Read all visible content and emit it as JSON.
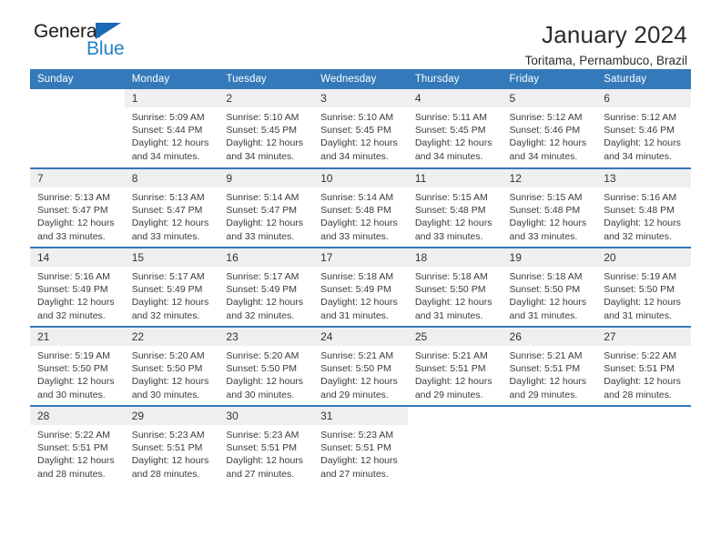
{
  "brand": {
    "name_part1": "General",
    "name_part2": "Blue",
    "triangle_icon": "triangle-icon",
    "accent_color": "#2581c4",
    "header_color": "#3479ba"
  },
  "header": {
    "title": "January 2024",
    "subtitle": "Toritama, Pernambuco, Brazil"
  },
  "weekday_headers": [
    "Sunday",
    "Monday",
    "Tuesday",
    "Wednesday",
    "Thursday",
    "Friday",
    "Saturday"
  ],
  "weeks": [
    [
      {
        "day": "",
        "sunrise": "",
        "sunset": "",
        "daylight1": "",
        "daylight2": ""
      },
      {
        "day": "1",
        "sunrise": "Sunrise: 5:09 AM",
        "sunset": "Sunset: 5:44 PM",
        "daylight1": "Daylight: 12 hours",
        "daylight2": "and 34 minutes."
      },
      {
        "day": "2",
        "sunrise": "Sunrise: 5:10 AM",
        "sunset": "Sunset: 5:45 PM",
        "daylight1": "Daylight: 12 hours",
        "daylight2": "and 34 minutes."
      },
      {
        "day": "3",
        "sunrise": "Sunrise: 5:10 AM",
        "sunset": "Sunset: 5:45 PM",
        "daylight1": "Daylight: 12 hours",
        "daylight2": "and 34 minutes."
      },
      {
        "day": "4",
        "sunrise": "Sunrise: 5:11 AM",
        "sunset": "Sunset: 5:45 PM",
        "daylight1": "Daylight: 12 hours",
        "daylight2": "and 34 minutes."
      },
      {
        "day": "5",
        "sunrise": "Sunrise: 5:12 AM",
        "sunset": "Sunset: 5:46 PM",
        "daylight1": "Daylight: 12 hours",
        "daylight2": "and 34 minutes."
      },
      {
        "day": "6",
        "sunrise": "Sunrise: 5:12 AM",
        "sunset": "Sunset: 5:46 PM",
        "daylight1": "Daylight: 12 hours",
        "daylight2": "and 34 minutes."
      }
    ],
    [
      {
        "day": "7",
        "sunrise": "Sunrise: 5:13 AM",
        "sunset": "Sunset: 5:47 PM",
        "daylight1": "Daylight: 12 hours",
        "daylight2": "and 33 minutes."
      },
      {
        "day": "8",
        "sunrise": "Sunrise: 5:13 AM",
        "sunset": "Sunset: 5:47 PM",
        "daylight1": "Daylight: 12 hours",
        "daylight2": "and 33 minutes."
      },
      {
        "day": "9",
        "sunrise": "Sunrise: 5:14 AM",
        "sunset": "Sunset: 5:47 PM",
        "daylight1": "Daylight: 12 hours",
        "daylight2": "and 33 minutes."
      },
      {
        "day": "10",
        "sunrise": "Sunrise: 5:14 AM",
        "sunset": "Sunset: 5:48 PM",
        "daylight1": "Daylight: 12 hours",
        "daylight2": "and 33 minutes."
      },
      {
        "day": "11",
        "sunrise": "Sunrise: 5:15 AM",
        "sunset": "Sunset: 5:48 PM",
        "daylight1": "Daylight: 12 hours",
        "daylight2": "and 33 minutes."
      },
      {
        "day": "12",
        "sunrise": "Sunrise: 5:15 AM",
        "sunset": "Sunset: 5:48 PM",
        "daylight1": "Daylight: 12 hours",
        "daylight2": "and 33 minutes."
      },
      {
        "day": "13",
        "sunrise": "Sunrise: 5:16 AM",
        "sunset": "Sunset: 5:48 PM",
        "daylight1": "Daylight: 12 hours",
        "daylight2": "and 32 minutes."
      }
    ],
    [
      {
        "day": "14",
        "sunrise": "Sunrise: 5:16 AM",
        "sunset": "Sunset: 5:49 PM",
        "daylight1": "Daylight: 12 hours",
        "daylight2": "and 32 minutes."
      },
      {
        "day": "15",
        "sunrise": "Sunrise: 5:17 AM",
        "sunset": "Sunset: 5:49 PM",
        "daylight1": "Daylight: 12 hours",
        "daylight2": "and 32 minutes."
      },
      {
        "day": "16",
        "sunrise": "Sunrise: 5:17 AM",
        "sunset": "Sunset: 5:49 PM",
        "daylight1": "Daylight: 12 hours",
        "daylight2": "and 32 minutes."
      },
      {
        "day": "17",
        "sunrise": "Sunrise: 5:18 AM",
        "sunset": "Sunset: 5:49 PM",
        "daylight1": "Daylight: 12 hours",
        "daylight2": "and 31 minutes."
      },
      {
        "day": "18",
        "sunrise": "Sunrise: 5:18 AM",
        "sunset": "Sunset: 5:50 PM",
        "daylight1": "Daylight: 12 hours",
        "daylight2": "and 31 minutes."
      },
      {
        "day": "19",
        "sunrise": "Sunrise: 5:18 AM",
        "sunset": "Sunset: 5:50 PM",
        "daylight1": "Daylight: 12 hours",
        "daylight2": "and 31 minutes."
      },
      {
        "day": "20",
        "sunrise": "Sunrise: 5:19 AM",
        "sunset": "Sunset: 5:50 PM",
        "daylight1": "Daylight: 12 hours",
        "daylight2": "and 31 minutes."
      }
    ],
    [
      {
        "day": "21",
        "sunrise": "Sunrise: 5:19 AM",
        "sunset": "Sunset: 5:50 PM",
        "daylight1": "Daylight: 12 hours",
        "daylight2": "and 30 minutes."
      },
      {
        "day": "22",
        "sunrise": "Sunrise: 5:20 AM",
        "sunset": "Sunset: 5:50 PM",
        "daylight1": "Daylight: 12 hours",
        "daylight2": "and 30 minutes."
      },
      {
        "day": "23",
        "sunrise": "Sunrise: 5:20 AM",
        "sunset": "Sunset: 5:50 PM",
        "daylight1": "Daylight: 12 hours",
        "daylight2": "and 30 minutes."
      },
      {
        "day": "24",
        "sunrise": "Sunrise: 5:21 AM",
        "sunset": "Sunset: 5:50 PM",
        "daylight1": "Daylight: 12 hours",
        "daylight2": "and 29 minutes."
      },
      {
        "day": "25",
        "sunrise": "Sunrise: 5:21 AM",
        "sunset": "Sunset: 5:51 PM",
        "daylight1": "Daylight: 12 hours",
        "daylight2": "and 29 minutes."
      },
      {
        "day": "26",
        "sunrise": "Sunrise: 5:21 AM",
        "sunset": "Sunset: 5:51 PM",
        "daylight1": "Daylight: 12 hours",
        "daylight2": "and 29 minutes."
      },
      {
        "day": "27",
        "sunrise": "Sunrise: 5:22 AM",
        "sunset": "Sunset: 5:51 PM",
        "daylight1": "Daylight: 12 hours",
        "daylight2": "and 28 minutes."
      }
    ],
    [
      {
        "day": "28",
        "sunrise": "Sunrise: 5:22 AM",
        "sunset": "Sunset: 5:51 PM",
        "daylight1": "Daylight: 12 hours",
        "daylight2": "and 28 minutes."
      },
      {
        "day": "29",
        "sunrise": "Sunrise: 5:23 AM",
        "sunset": "Sunset: 5:51 PM",
        "daylight1": "Daylight: 12 hours",
        "daylight2": "and 28 minutes."
      },
      {
        "day": "30",
        "sunrise": "Sunrise: 5:23 AM",
        "sunset": "Sunset: 5:51 PM",
        "daylight1": "Daylight: 12 hours",
        "daylight2": "and 27 minutes."
      },
      {
        "day": "31",
        "sunrise": "Sunrise: 5:23 AM",
        "sunset": "Sunset: 5:51 PM",
        "daylight1": "Daylight: 12 hours",
        "daylight2": "and 27 minutes."
      },
      {
        "day": "",
        "sunrise": "",
        "sunset": "",
        "daylight1": "",
        "daylight2": ""
      },
      {
        "day": "",
        "sunrise": "",
        "sunset": "",
        "daylight1": "",
        "daylight2": ""
      },
      {
        "day": "",
        "sunrise": "",
        "sunset": "",
        "daylight1": "",
        "daylight2": ""
      }
    ]
  ]
}
